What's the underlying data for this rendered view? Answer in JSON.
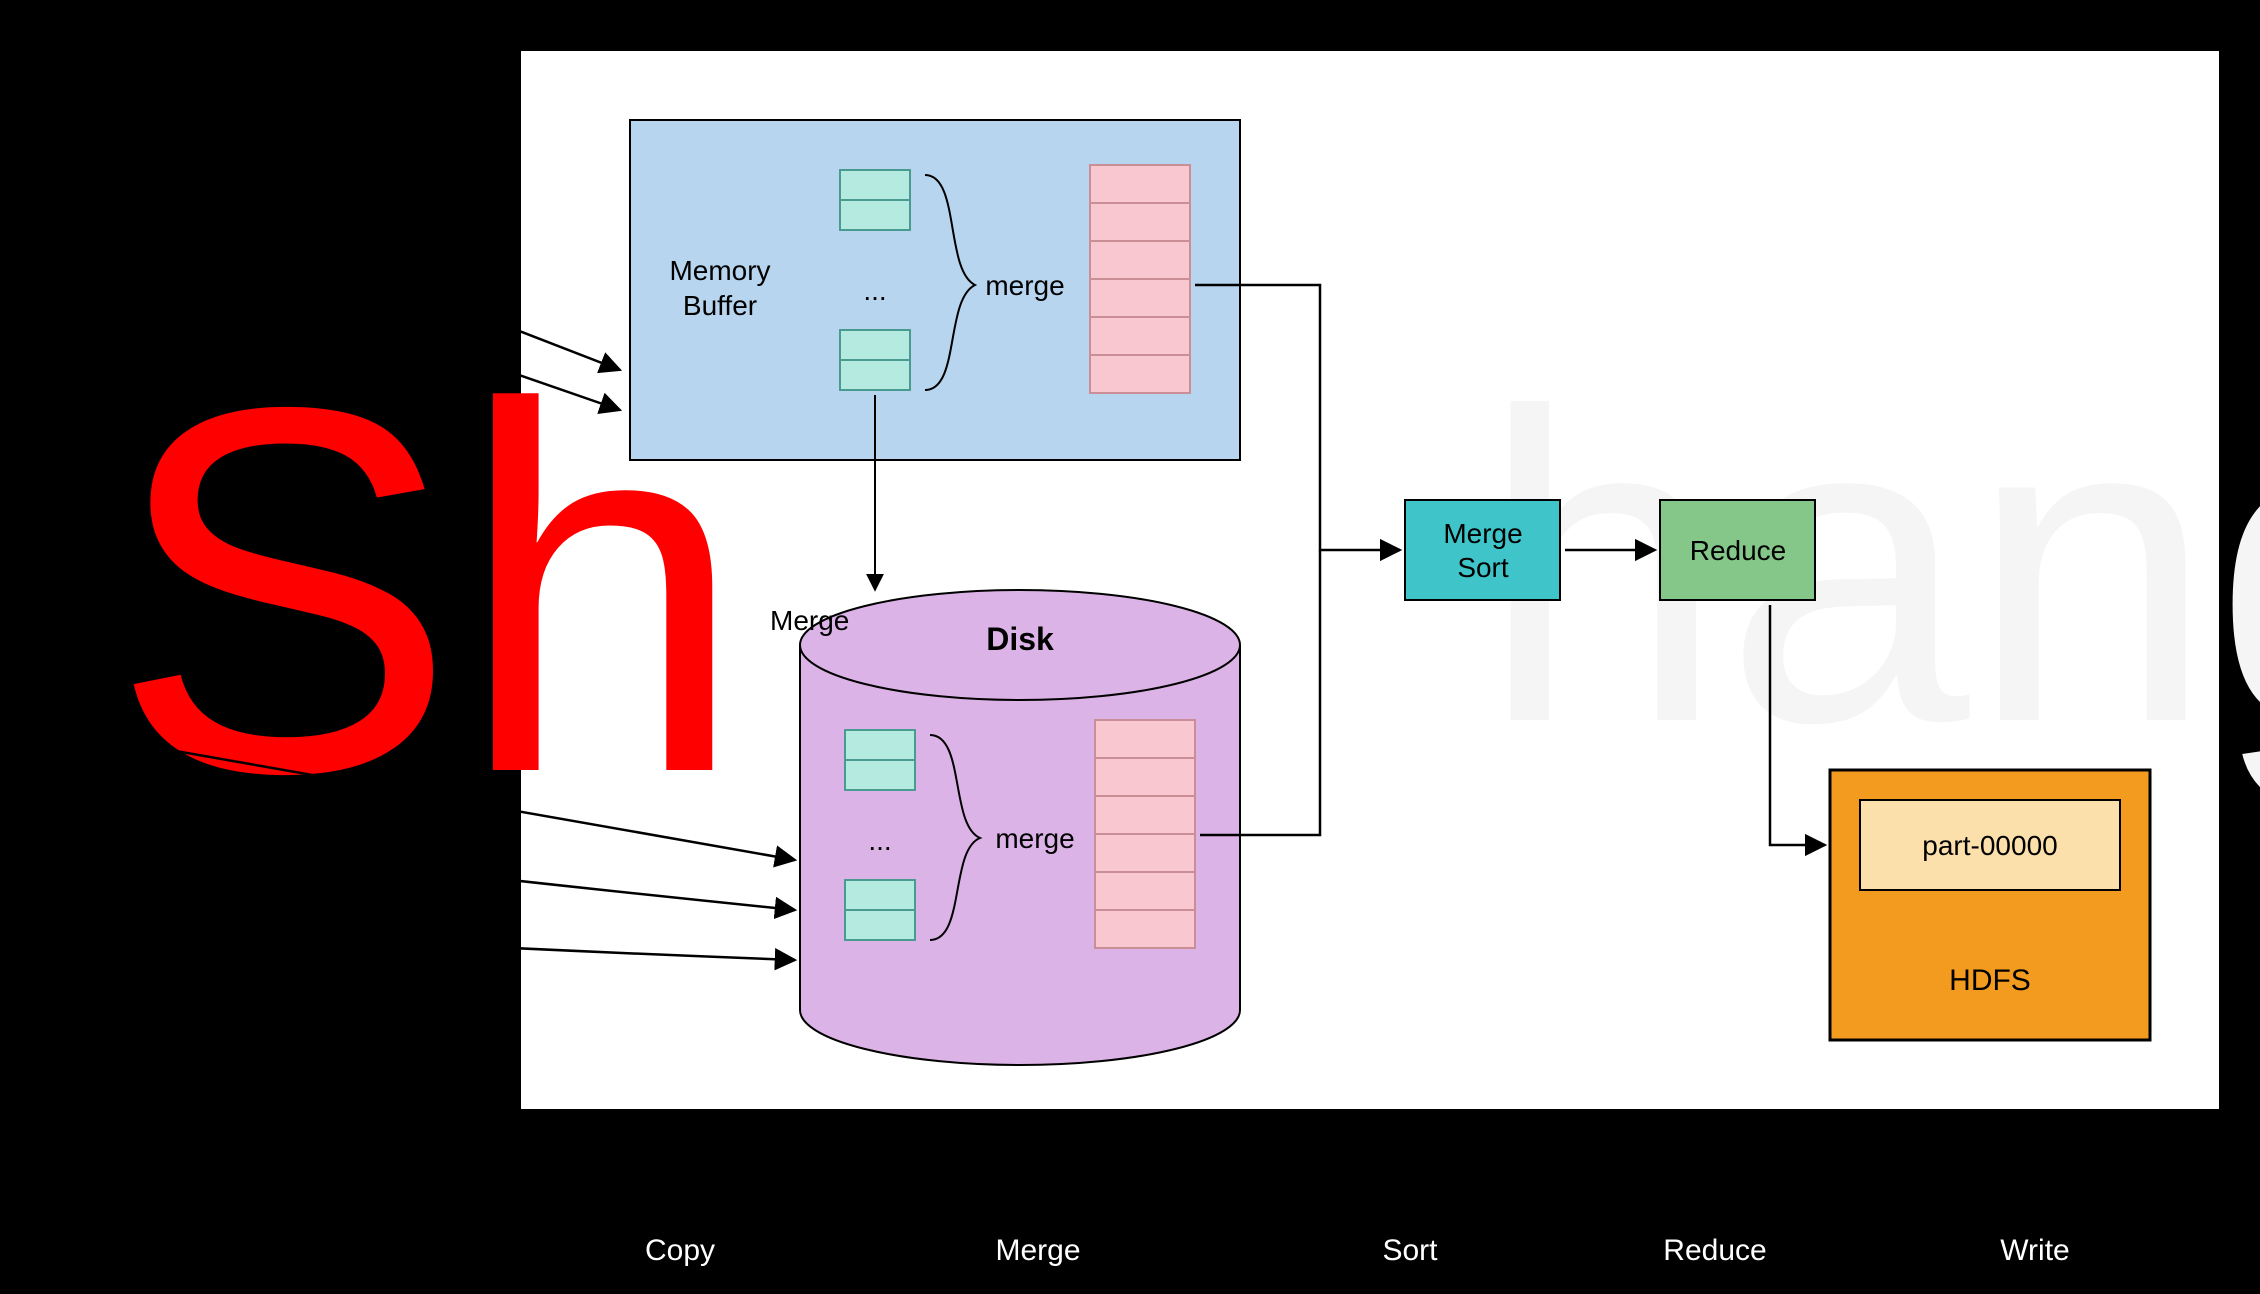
{
  "watermark": "Sh",
  "memoryBufferBox": {
    "label1": "Memory",
    "label2": "Buffer",
    "ellipsis": "...",
    "merge": "merge"
  },
  "disk": {
    "title": "Disk",
    "ellipsis": "...",
    "merge": "merge",
    "mergeSide": "Merge"
  },
  "mergeSort": {
    "line1": "Merge",
    "line2": "Sort"
  },
  "reduce": "Reduce",
  "hdfs": {
    "part": "part-00000",
    "label": "HDFS"
  },
  "phases": {
    "copy": "Copy",
    "merge": "Merge",
    "sort": "Sort",
    "reduce": "Reduce",
    "write": "Write"
  },
  "colors": {
    "memBg": "#b7d5ee",
    "memStroke": "#000",
    "cellFill": "#b5eae1",
    "cellStroke": "#4a9b8f",
    "pinkFill": "#f9c7cf",
    "pinkStroke": "#c98e96",
    "diskFill": "#dcb3e6",
    "diskStroke": "#000",
    "mergeSortFill": "#3fc4c9",
    "mergeSortStroke": "#000",
    "reduceFill": "#84c789",
    "reduceStroke": "#000",
    "hdfsFill": "#f39b1f",
    "hdfsStroke": "#000",
    "partFill": "#fbe0ab",
    "partStroke": "#000",
    "watermark": "#ff0000",
    "watermark2": "#f7f7f7"
  }
}
